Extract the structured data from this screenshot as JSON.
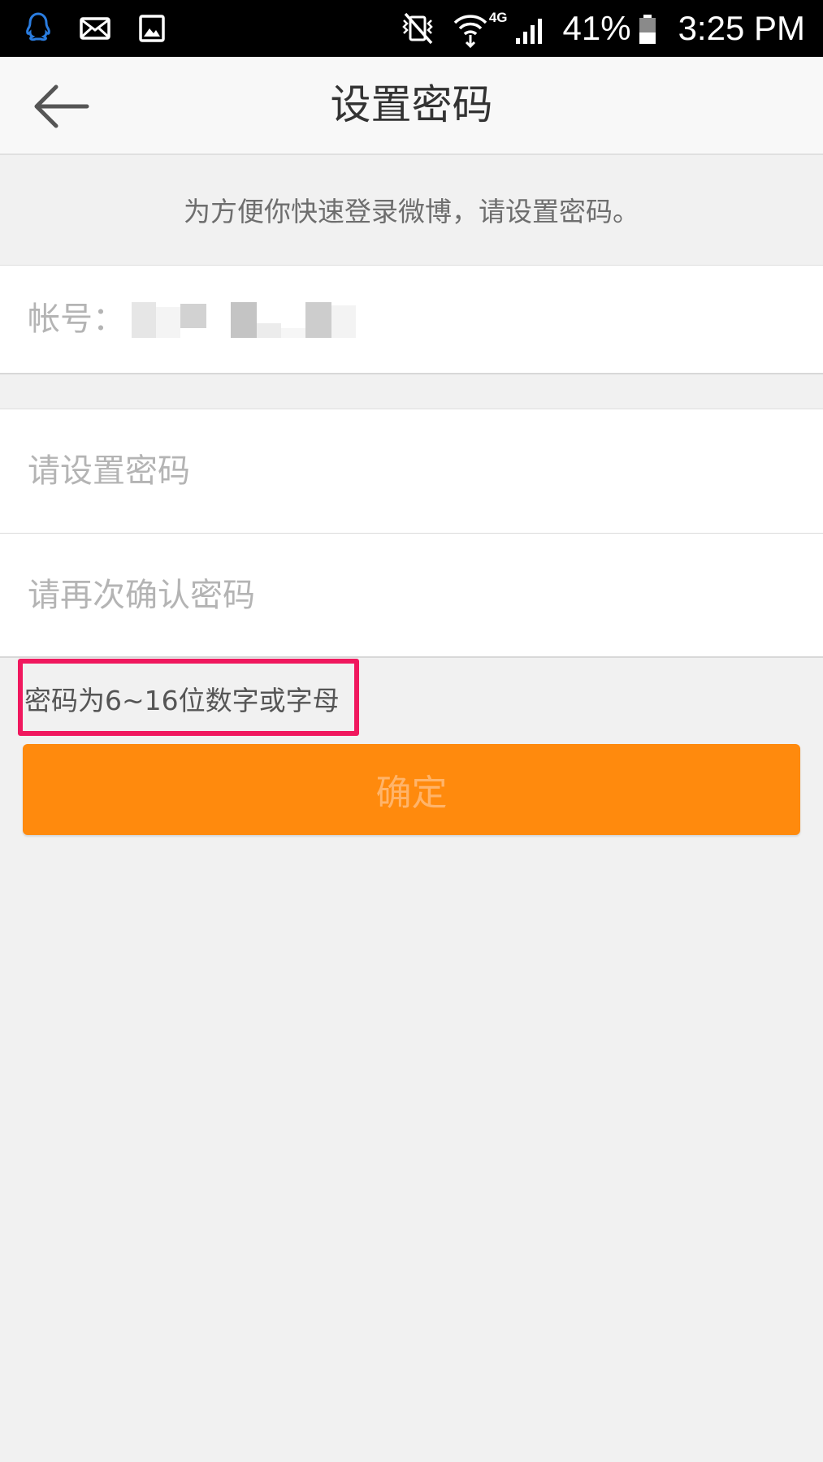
{
  "status_bar": {
    "battery": "41%",
    "network_type": "4G",
    "time": "3:25 PM"
  },
  "header": {
    "title": "设置密码"
  },
  "hint": "为方便你快速登录微博，请设置密码。",
  "account": {
    "label": "帐号："
  },
  "password": {
    "placeholder": "请设置密码",
    "confirm_placeholder": "请再次确认密码"
  },
  "rule_text": "密码为6~16位数字或字母",
  "confirm_button": "确定",
  "colors": {
    "accent": "#ff8a0d",
    "highlight": "#f0185e"
  }
}
